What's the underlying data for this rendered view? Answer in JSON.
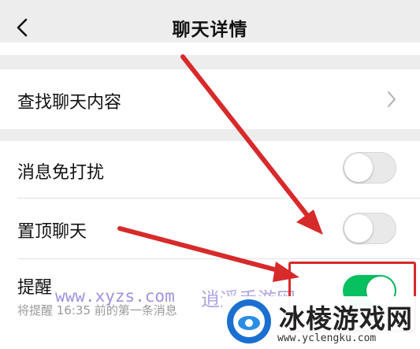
{
  "header": {
    "title": "聊天详情",
    "back_icon": "chevron-left-icon"
  },
  "search_row": {
    "label": "查找聊天内容",
    "icon": "chevron-right-icon"
  },
  "settings": {
    "do_not_disturb": {
      "label": "消息免打扰",
      "enabled": false
    },
    "pin_chat": {
      "label": "置顶聊天",
      "enabled": false
    },
    "reminder": {
      "label": "提醒",
      "sublabel": "将提醒 16:35 前的第一条消息",
      "enabled": true
    }
  },
  "overlay": {
    "watermark_url": "www.xyzs.com",
    "watermark_text": "逍遥手游网",
    "arrow_color": "#d72a2a",
    "toggle_on_color": "#07c160"
  },
  "logo": {
    "name": "冰棱游戏网",
    "url": "www.yclengku.com"
  }
}
